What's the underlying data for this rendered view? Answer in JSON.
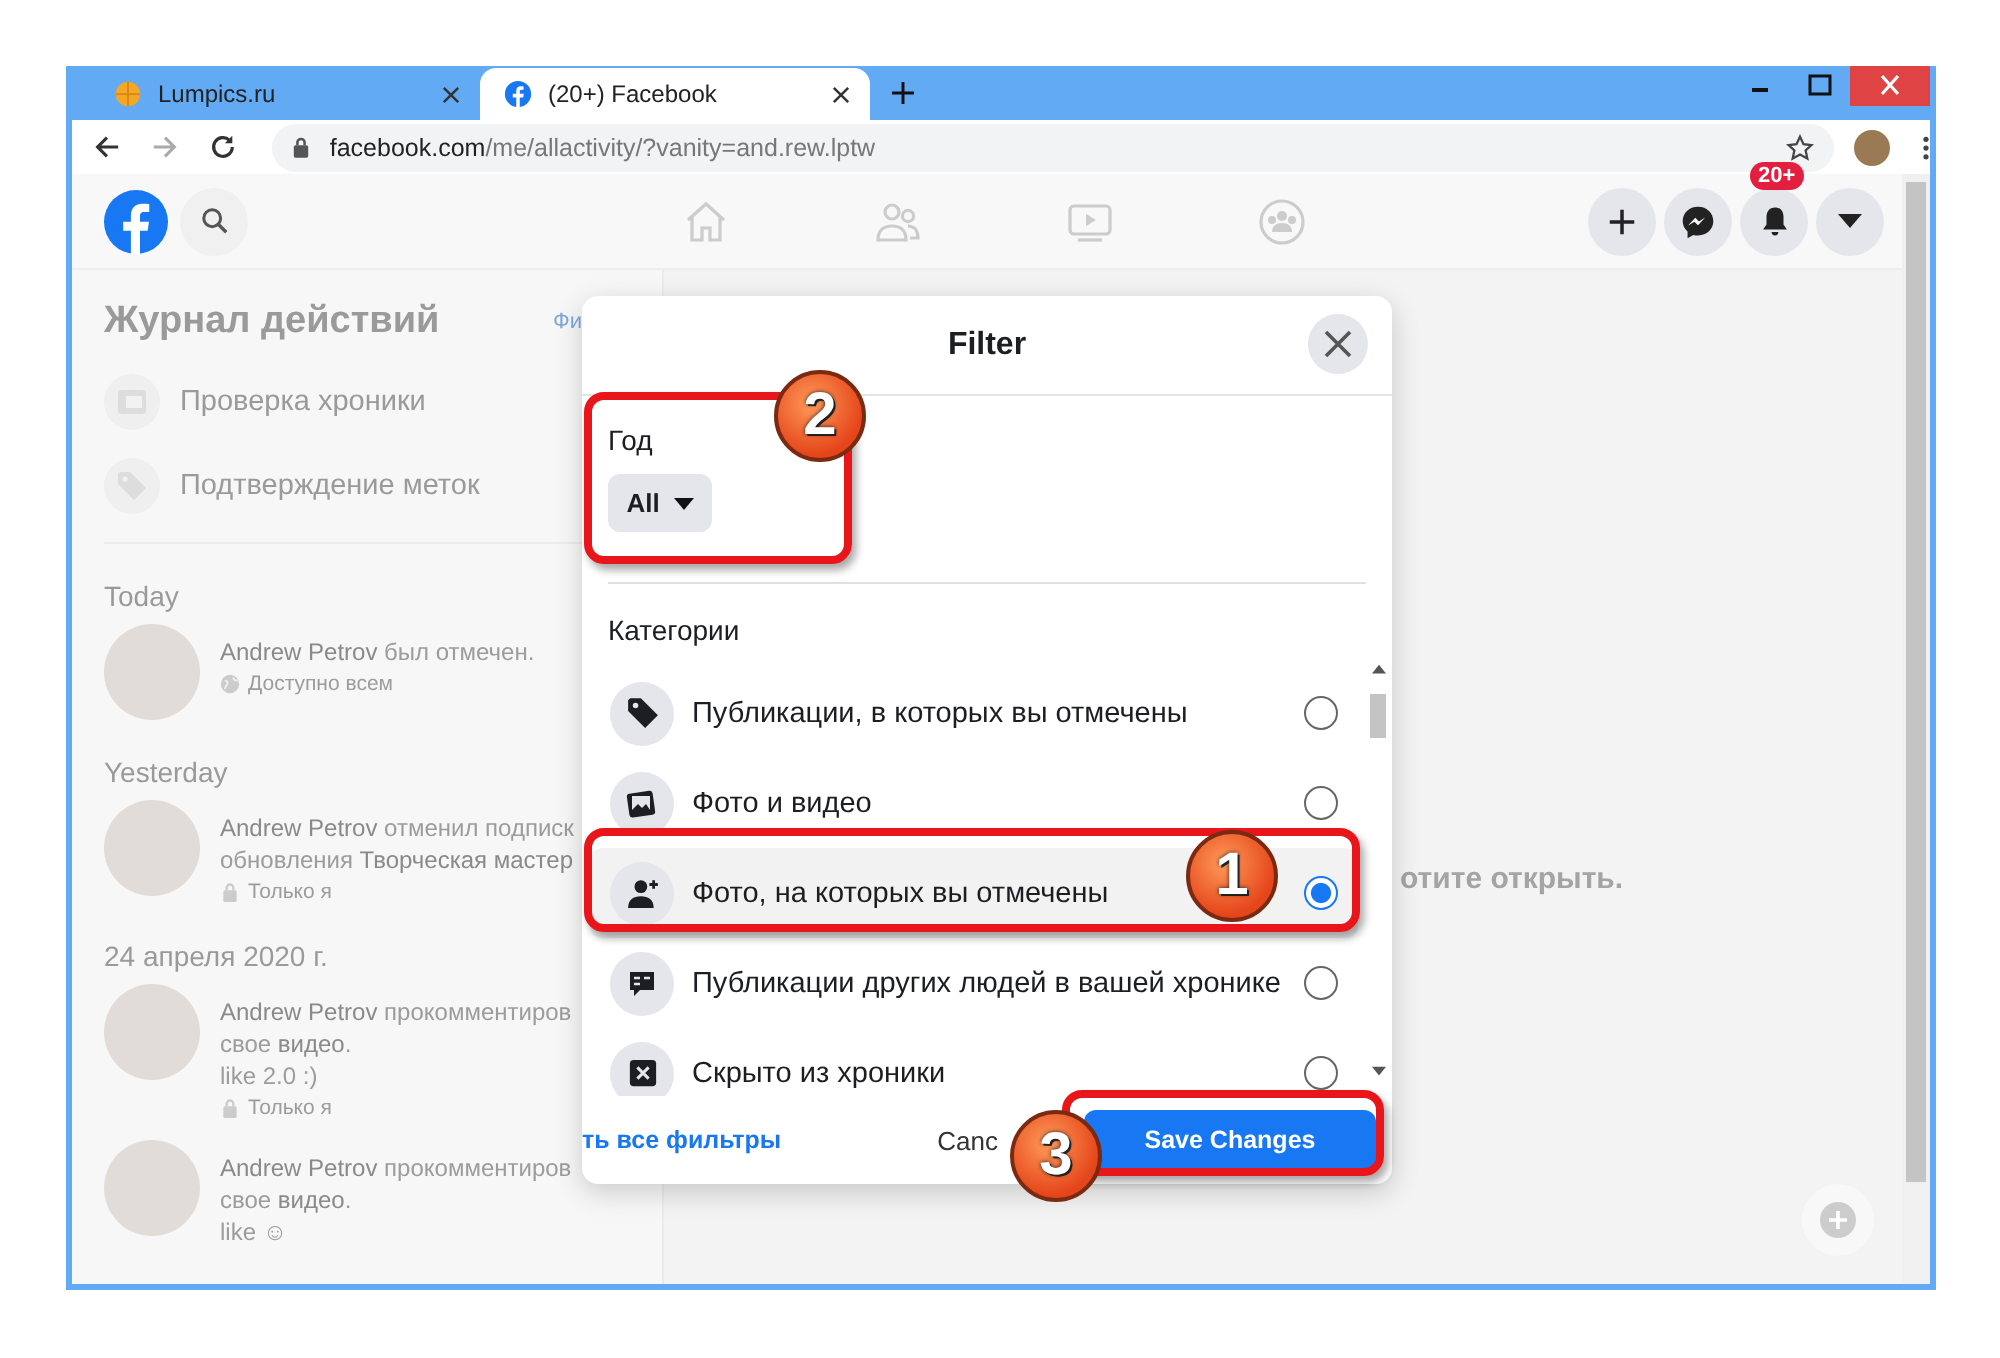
{
  "browser": {
    "tabs": [
      {
        "title": "Lumpics.ru",
        "kind": "site",
        "selected": false
      },
      {
        "title": "(20+) Facebook",
        "kind": "facebook",
        "selected": true
      }
    ],
    "url_domain": "facebook.com",
    "url_path": "/me/allactivity/?vanity=and.rew.lptw"
  },
  "header": {
    "notification_badge": "20+"
  },
  "sidebar": {
    "title": "Журнал действий",
    "filter_link": "Фи",
    "items": [
      {
        "label": "Проверка хроники",
        "kind": "timeline"
      },
      {
        "label": "Подтверждение меток",
        "kind": "tag"
      }
    ],
    "sections": [
      {
        "heading": "Today",
        "entries": [
          {
            "lines": [
              "**Andrew Petrov** был отмечен."
            ],
            "kind": "public",
            "audience_label": "Доступно всем"
          }
        ]
      },
      {
        "heading": "Yesterday",
        "entries": [
          {
            "lines": [
              "**Andrew Petrov** отменил подписк",
              "обновления **Творческая мастер**"
            ],
            "kind": "private",
            "audience_label": "Только я"
          }
        ]
      },
      {
        "heading": "24 апреля 2020 г.",
        "entries": [
          {
            "lines": [
              "**Andrew Petrov** прокомментиров",
              "свое **видео**.",
              "like 2.0 :)"
            ],
            "kind": "private",
            "audience_label": "Только я"
          },
          {
            "lines": [
              "**Andrew Petrov** прокомментиров",
              "свое **видео**.",
              "like ☺"
            ]
          }
        ]
      }
    ]
  },
  "main": {
    "message": "отите открыть."
  },
  "dialog": {
    "title": "Filter",
    "year_label": "Год",
    "year_value": "All",
    "categories_label": "Категории",
    "categories": [
      {
        "label": "Публикации, в которых вы отмечены",
        "kind": "tag",
        "selected": false
      },
      {
        "label": "Фото и видео",
        "kind": "photo",
        "selected": false
      },
      {
        "label": "Фото, на которых вы отмечены",
        "kind": "person",
        "selected": true
      },
      {
        "label": "Публикации других людей в вашей хронике",
        "kind": "comment",
        "selected": false
      },
      {
        "label": "Скрыто из хроники",
        "kind": "hidden",
        "selected": false
      }
    ],
    "clear_link": "ть все фильтры",
    "cancel": "Canc",
    "save": "Save Changes"
  },
  "callouts": [
    {
      "number": "1",
      "kind": "category"
    },
    {
      "number": "2",
      "kind": "year"
    },
    {
      "number": "3",
      "kind": "save"
    }
  ]
}
